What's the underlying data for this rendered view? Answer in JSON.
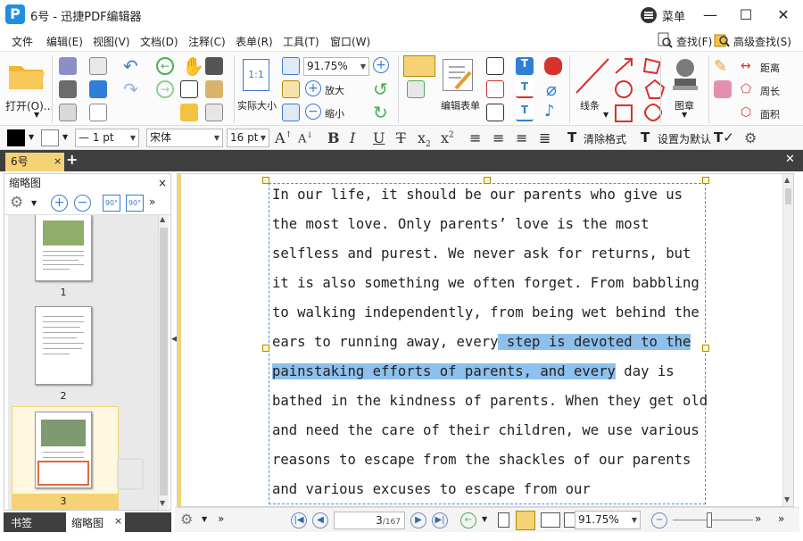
{
  "window": {
    "title": "6号 - 迅捷PDF编辑器",
    "logo": "P",
    "menu_label": "菜单",
    "min": "—",
    "max": "☐",
    "close": "✕"
  },
  "menubar": {
    "items": [
      "文件",
      "编辑(E)",
      "视图(V)",
      "文档(D)",
      "注释(C)",
      "表单(R)",
      "工具(T)",
      "窗口(W)"
    ],
    "search": "查找(F)",
    "adv_search": "高级查找(S)"
  },
  "ribbon": {
    "open": "打开(O)...",
    "zoom_value": "91.75%",
    "zoom_in": "放大",
    "zoom_out": "缩小",
    "actual_size": "实际大小",
    "actual_glyph": "1:1",
    "edit_form": "编辑表单",
    "lines": "线条",
    "stamp": "图章",
    "distance": "距离",
    "perimeter": "周长",
    "area": "面积"
  },
  "fmtbar": {
    "line_width": "— 1 pt",
    "font": "宋体",
    "font_size": "16 pt",
    "clear_format": "清除格式",
    "set_default": "设置为默认"
  },
  "tabs": {
    "doc_tab": "6号",
    "add": "+",
    "close_all": "✕"
  },
  "left_panel": {
    "title": "缩略图",
    "close": "×",
    "rot_left": "90°",
    "rot_right": "90°",
    "pages": [
      "1",
      "2",
      "3"
    ],
    "bottom_tabs": [
      "书签",
      "缩略图"
    ]
  },
  "document": {
    "lines": [
      {
        "pre": "In our life, it should be our parents who give us",
        "hl": "",
        "post": ""
      },
      {
        "pre": "the most love. Only parents’ love is the most",
        "hl": "",
        "post": ""
      },
      {
        "pre": "selfless and purest. We never ask for returns, but",
        "hl": "",
        "post": ""
      },
      {
        "pre": "it is also something we often forget. From babbling",
        "hl": "",
        "post": ""
      },
      {
        "pre": "to walking independently, from being wet behind the",
        "hl": "",
        "post": ""
      },
      {
        "pre": "ears to running away, every",
        "hl": " step is devoted to the",
        "post": ""
      },
      {
        "pre": "",
        "hl": "painstaking efforts of parents, and every",
        "post": " day is"
      },
      {
        "pre": "bathed in the kindness of parents. When they get old",
        "hl": "",
        "post": ""
      },
      {
        "pre": "and need the care of their children, we use various",
        "hl": "",
        "post": ""
      },
      {
        "pre": "reasons to escape from the shackles of our parents",
        "hl": "",
        "post": ""
      },
      {
        "pre": "and various excuses to escape from our",
        "hl": "",
        "post": ""
      }
    ]
  },
  "status": {
    "page_current": "3",
    "page_total": "/167",
    "zoom": "91.75%"
  }
}
